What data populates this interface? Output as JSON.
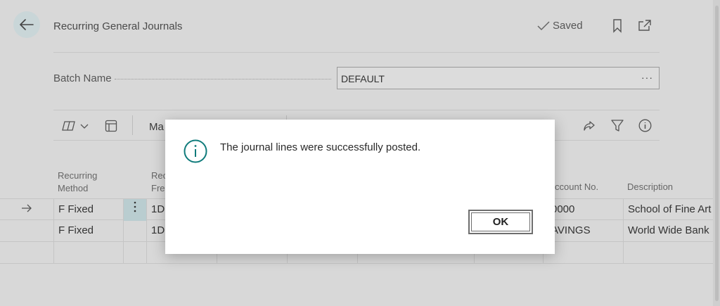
{
  "header": {
    "title": "Recurring General Journals",
    "saved_label": "Saved"
  },
  "batch": {
    "label": "Batch Name",
    "value": "DEFAULT",
    "lookup": "···"
  },
  "toolbar": {
    "partial_label": "Ma"
  },
  "grid": {
    "headers": {
      "recurring_method": [
        "Recurring",
        "Method"
      ],
      "recurring_frequency": [
        "Rec",
        "Fre"
      ],
      "account_no": "ccount No.",
      "description": "Description"
    },
    "rows": [
      {
        "method": "F Fixed",
        "frequency": "1D",
        "account_no": "0000",
        "description": "School of Fine Art"
      },
      {
        "method": "F  Fixed",
        "frequency": "1D",
        "account_no": "AVINGS",
        "description": "World Wide Bank"
      }
    ]
  },
  "dialog": {
    "message": "The journal lines were successfully posted.",
    "ok_label": "OK"
  },
  "colors": {
    "accent": "#0f7b7b",
    "backdrop": "#d8d8d8"
  }
}
